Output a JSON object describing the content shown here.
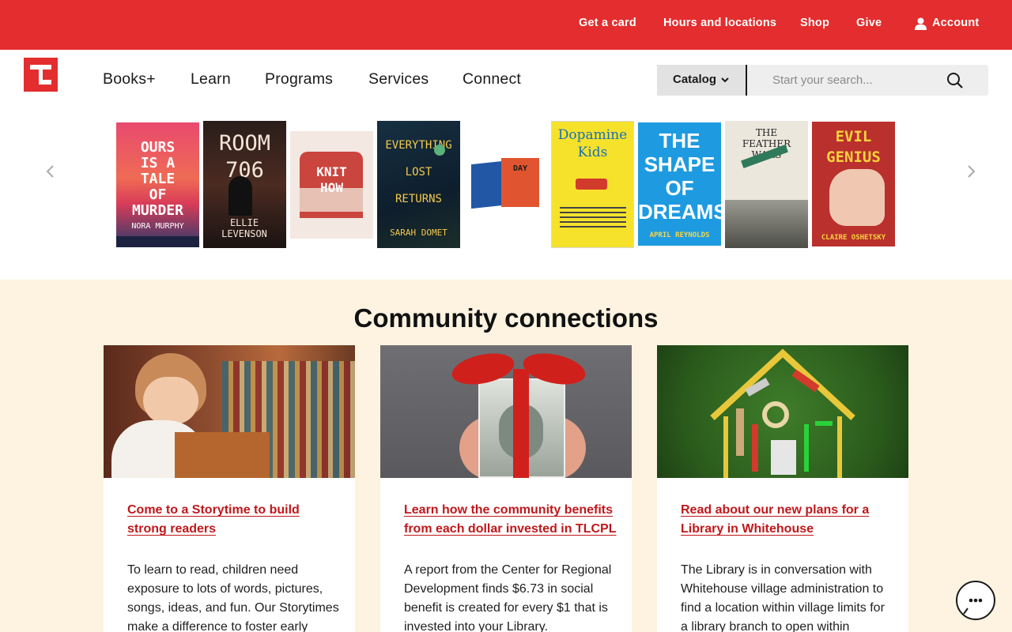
{
  "utility_nav": {
    "get_card": "Get a card",
    "hours": "Hours and locations",
    "shop": "Shop",
    "give": "Give",
    "account": "Account"
  },
  "main_nav": {
    "items": [
      "Books+",
      "Learn",
      "Programs",
      "Services",
      "Connect"
    ]
  },
  "search": {
    "scope": "Catalog",
    "placeholder": "Start your search..."
  },
  "carousel": {
    "books": [
      {
        "lines": [
          "OURS",
          "IS A",
          "TALE",
          "OF",
          "MURDER"
        ],
        "author": "NORA MURPHY"
      },
      {
        "lines": [
          "ROOM",
          "706"
        ],
        "author": "ELLIE LEVENSON"
      },
      {
        "lines": [
          "KNIT",
          "HOW"
        ],
        "author": ""
      },
      {
        "lines": [
          "EVERYTHING",
          "LOST",
          "RETURNS"
        ],
        "author": "SARAH DOMET"
      },
      {
        "lines": [
          "DAY"
        ],
        "author": ""
      },
      {
        "lines": [
          "Dopamine",
          "Kids"
        ],
        "author": ""
      },
      {
        "lines": [
          "THE",
          "SHAPE",
          "OF",
          "DREAMS"
        ],
        "author": "APRIL REYNOLDS"
      },
      {
        "lines": [
          "THE",
          "FEATHER",
          "WARS"
        ],
        "author": ""
      },
      {
        "lines": [
          "EVIL",
          "GENIUS"
        ],
        "author": "CLAIRE OSHETSKY"
      }
    ]
  },
  "community": {
    "title": "Community connections",
    "cards": [
      {
        "link": "Come to a Storytime to build strong readers",
        "body": "To learn to read, children need exposure to lots of words, pictures, songs, ideas, and fun. Our Storytimes make a difference to foster early"
      },
      {
        "link": "Learn how the community benefits from each dollar invested in TLCPL",
        "body": "A report from the Center for Regional Development finds $6.73 in social benefit is created for every $1 that is invested into your Library."
      },
      {
        "link": "Read about our new plans for a Library in Whitehouse",
        "body": "The Library is in conversation with Whitehouse village administration to find a location within village limits for a library branch to open within"
      }
    ]
  },
  "colors": {
    "brand_red": "#e32d2e",
    "link_red": "#c0181b",
    "section_bg": "#fdf3e0"
  }
}
